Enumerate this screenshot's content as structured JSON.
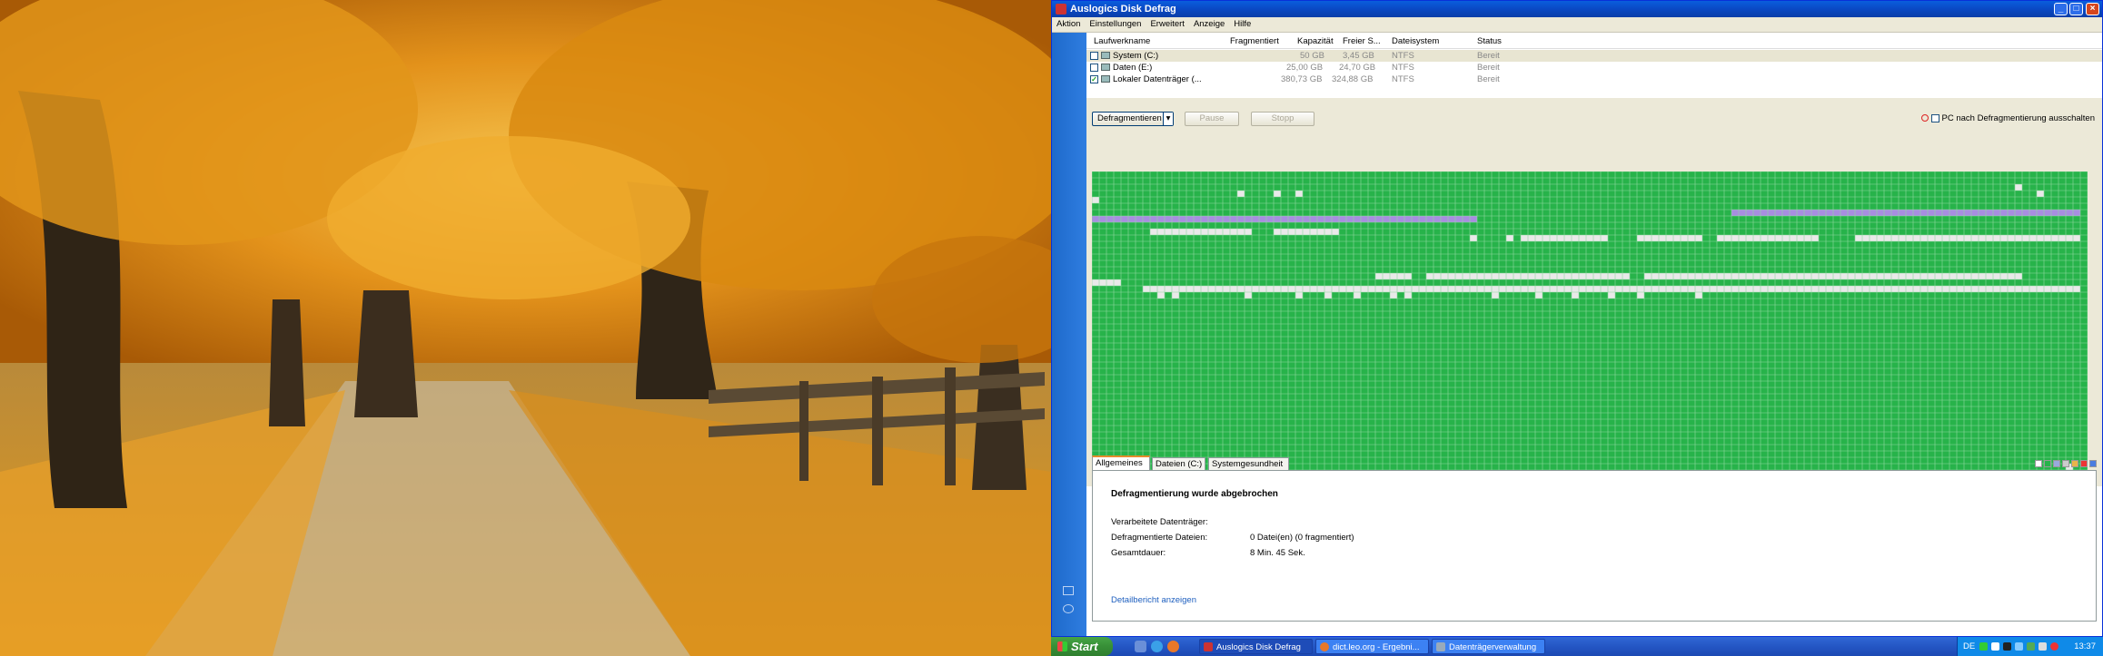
{
  "window": {
    "title": "Auslogics Disk Defrag",
    "controls": {
      "minimize": "_",
      "maximize": "□",
      "close": "×"
    }
  },
  "menu": [
    "Aktion",
    "Einstellungen",
    "Erweitert",
    "Anzeige",
    "Hilfe"
  ],
  "drives": {
    "columns": [
      "Laufwerkname",
      "Fragmentiert",
      "Kapazität",
      "Freier S...",
      "Dateisystem",
      "Status"
    ],
    "rows": [
      {
        "name": "System (C:)",
        "fragmented": "",
        "capacity": "50 GB",
        "free": "3,45 GB",
        "fs": "NTFS",
        "status": "Bereit",
        "checked": false,
        "selected": true
      },
      {
        "name": "Daten (E:)",
        "fragmented": "",
        "capacity": "25,00 GB",
        "free": "24,70 GB",
        "fs": "NTFS",
        "status": "Bereit",
        "checked": false,
        "selected": false
      },
      {
        "name": "Lokaler Datenträger (...",
        "fragmented": "",
        "capacity": "380,73 GB",
        "free": "324,88 GB",
        "fs": "NTFS",
        "status": "Bereit",
        "checked": true,
        "selected": false
      }
    ]
  },
  "toolbar": {
    "defrag_label": "Defragmentieren",
    "dropdown_glyph": "▾",
    "pause_label": "Pause",
    "stop_label": "Stopp",
    "shutdown_label": "PC nach Defragmentierung ausschalten"
  },
  "colors": {
    "cluster_used": "#27b34a",
    "cluster_free": "#e9e9e9",
    "cluster_mft": "#a88ee0",
    "grid_line": "#8fd9a0",
    "accent": "#0a5ddc"
  },
  "tabs": [
    "Allgemeines",
    "Dateien (C:)",
    "Systemgesundheit"
  ],
  "info": {
    "heading": "Defragmentierung wurde abgebrochen",
    "rows": [
      {
        "label": "Verarbeitete Datenträger:",
        "value": ""
      },
      {
        "label": "Defragmentierte Dateien:",
        "value": "0 Datei(en) (0 fragmentiert)"
      },
      {
        "label": "Gesamtdauer:",
        "value": "8 Min. 45 Sek."
      }
    ],
    "report_link": "Detailbericht anzeigen"
  },
  "taskbar": {
    "start_label": "Start",
    "tasks": [
      {
        "label": "Auslogics Disk Defrag",
        "active": true
      },
      {
        "label": "dict.leo.org - Ergebni...",
        "active": false
      },
      {
        "label": "Datenträgerverwaltung",
        "active": false
      }
    ],
    "language": "DE",
    "clock": "13:37"
  },
  "icons": {
    "left_panel": [
      "list-view-icon",
      "clock-icon"
    ],
    "quicklaunch": [
      "show-desktop-icon",
      "internet-explorer-icon",
      "firefox-icon"
    ]
  }
}
